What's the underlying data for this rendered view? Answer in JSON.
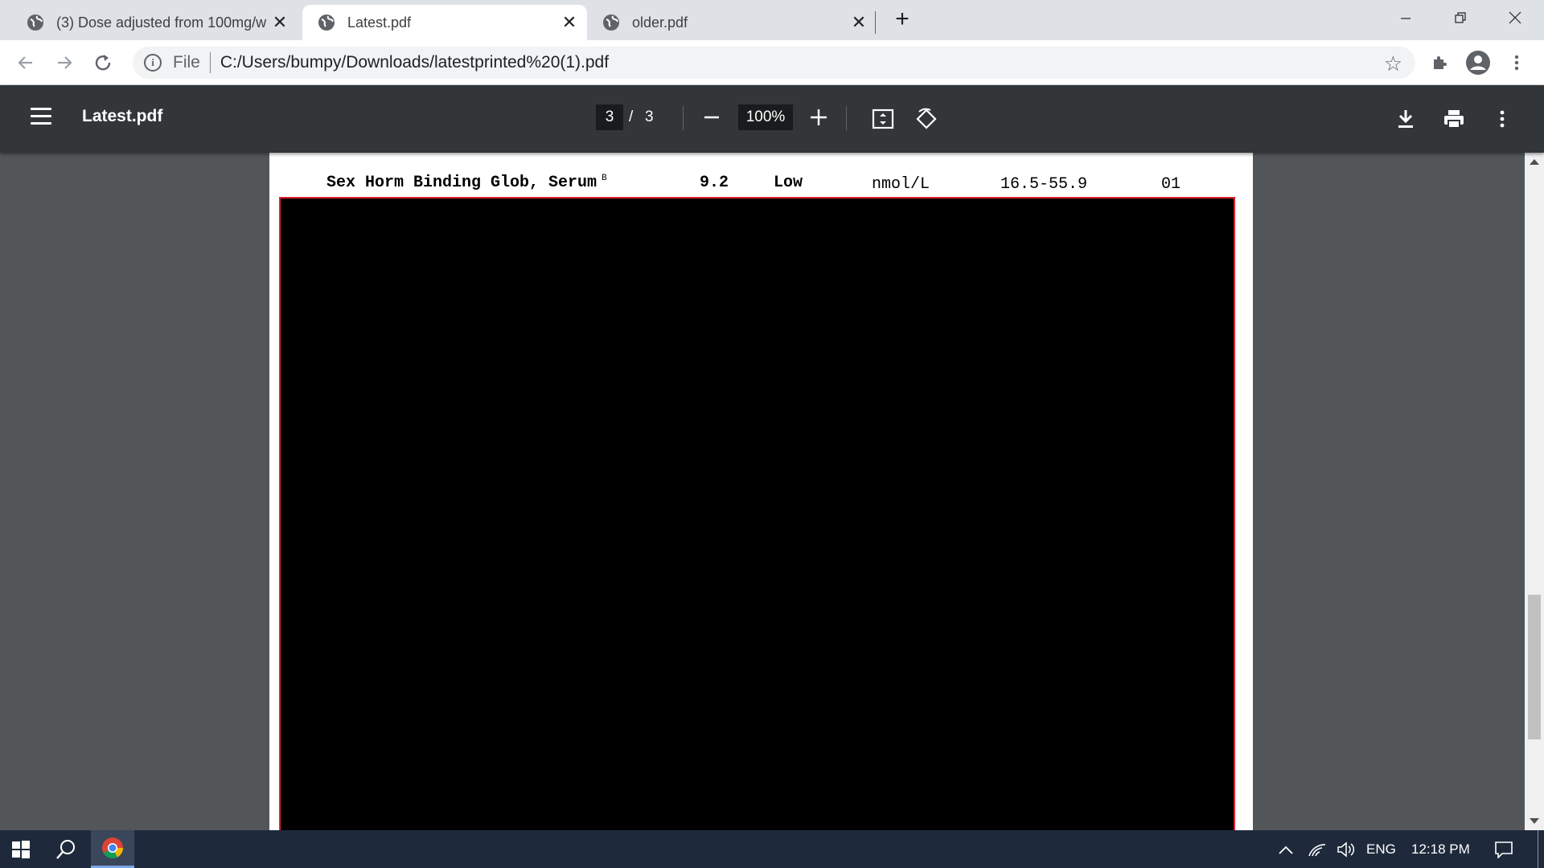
{
  "browser": {
    "tabs": [
      {
        "title": "(3) Dose adjusted from 100mg/w",
        "active": false
      },
      {
        "title": "Latest.pdf",
        "active": true
      },
      {
        "title": "older.pdf",
        "active": false
      }
    ],
    "address": {
      "scheme": "File",
      "url": "C:/Users/bumpy/Downloads/latestprinted%20(1).pdf"
    }
  },
  "pdf_viewer": {
    "title": "Latest.pdf",
    "current_page": "3",
    "page_separator": "/",
    "total_pages": "3",
    "zoom": "100%"
  },
  "document": {
    "row": {
      "test": "Sex Horm Binding Glob, Serum",
      "superscript": "B",
      "value": "9.2",
      "flag": "Low",
      "units": "nmol/L",
      "reference": "16.5-55.9",
      "lab": "01"
    }
  },
  "scroll": {
    "position_fraction": 0.85
  },
  "taskbar": {
    "language": "ENG",
    "time": "12:18 PM"
  },
  "colors": {
    "pdf_toolbar": "#323639",
    "viewer_bg": "#525659",
    "redaction_border": "#e0202a",
    "taskbar": "#1e2a3c"
  }
}
